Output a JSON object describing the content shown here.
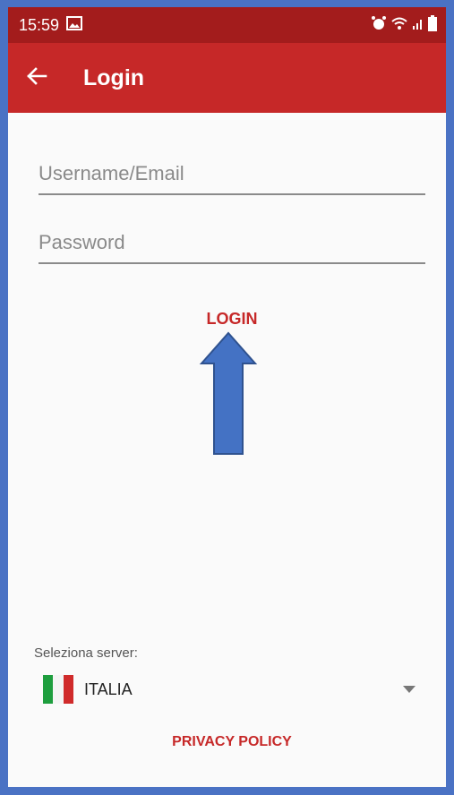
{
  "status_bar": {
    "time": "15:59",
    "icons": [
      "image-icon",
      "alarm-icon",
      "wifi-icon",
      "signal-icon",
      "battery-icon"
    ]
  },
  "app_bar": {
    "title": "Login",
    "back_icon": "arrow-left-icon",
    "color": "#c62828"
  },
  "form": {
    "username_placeholder": "Username/Email",
    "username_value": "",
    "password_placeholder": "Password",
    "password_value": "",
    "login_label": "LOGIN"
  },
  "annotation": {
    "arrow_icon": "up-arrow-icon",
    "arrow_color": "#4472c4"
  },
  "server": {
    "label": "Seleziona server:",
    "selected": "ITALIA",
    "flag_icon": "italy-flag-icon"
  },
  "footer": {
    "privacy_label": "PRIVACY POLICY"
  },
  "colors": {
    "accent": "#c62828",
    "status_bar": "#a31c1c",
    "frame_border": "#4a72c4"
  }
}
